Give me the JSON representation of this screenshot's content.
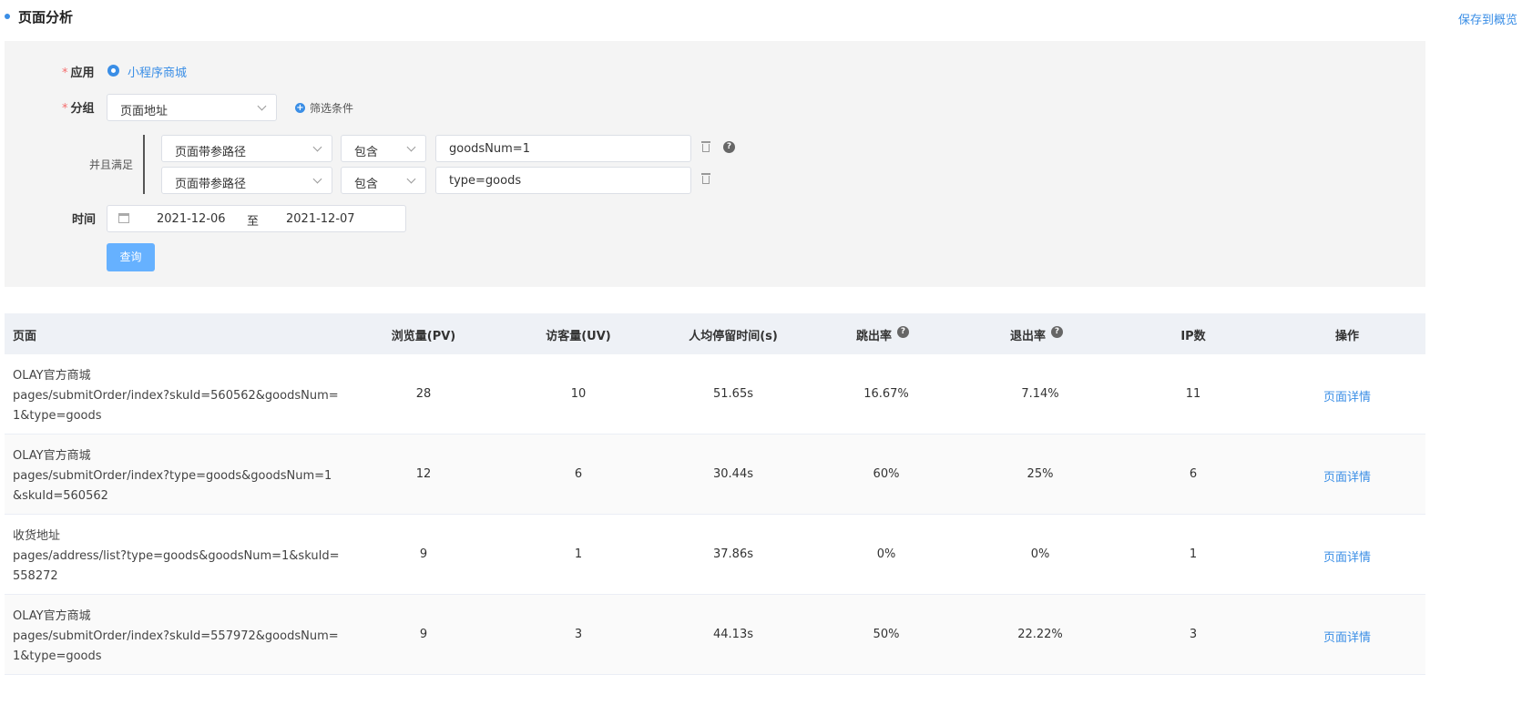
{
  "header": {
    "title": "页面分析",
    "save_label": "保存到概览"
  },
  "filters": {
    "required_mark": "*",
    "app_label": "应用",
    "app_value": "小程序商城",
    "group_label": "分组",
    "group_value": "页面地址",
    "add_filter_label": "筛选条件",
    "and_label": "并且满足",
    "conditions": [
      {
        "field": "页面带参路径",
        "operator": "包含",
        "value": "goodsNum=1"
      },
      {
        "field": "页面带参路径",
        "operator": "包含",
        "value": "type=goods"
      }
    ],
    "time_label": "时间",
    "date_start": "2021-12-06",
    "date_separator": "至",
    "date_end": "2021-12-07",
    "query_label": "查询"
  },
  "table": {
    "columns": [
      "页面",
      "浏览量(PV)",
      "访客量(UV)",
      "人均停留时间(s)",
      "跳出率",
      "退出率",
      "IP数",
      "操作"
    ],
    "rows": [
      {
        "name": "OLAY官方商城",
        "path": "pages/submitOrder/index?skuId=560562&goodsNum=1&type=goods",
        "pv": "28",
        "uv": "10",
        "avg_time": "51.65s",
        "bounce": "16.67%",
        "exit": "7.14%",
        "ip": "11",
        "action": "页面详情"
      },
      {
        "name": "OLAY官方商城",
        "path": "pages/submitOrder/index?type=goods&goodsNum=1&skuId=560562",
        "pv": "12",
        "uv": "6",
        "avg_time": "30.44s",
        "bounce": "60%",
        "exit": "25%",
        "ip": "6",
        "action": "页面详情"
      },
      {
        "name": "收货地址",
        "path": "pages/address/list?type=goods&goodsNum=1&skuId=558272",
        "pv": "9",
        "uv": "1",
        "avg_time": "37.86s",
        "bounce": "0%",
        "exit": "0%",
        "ip": "1",
        "action": "页面详情"
      },
      {
        "name": "OLAY官方商城",
        "path": "pages/submitOrder/index?skuId=557972&goodsNum=1&type=goods",
        "pv": "9",
        "uv": "3",
        "avg_time": "44.13s",
        "bounce": "50%",
        "exit": "22.22%",
        "ip": "3",
        "action": "页面详情"
      }
    ]
  },
  "colors": {
    "accent": "#3a8ee6",
    "button": "#66b1ff",
    "panel_bg": "#f4f4f4",
    "header_bg": "#eef1f6"
  }
}
